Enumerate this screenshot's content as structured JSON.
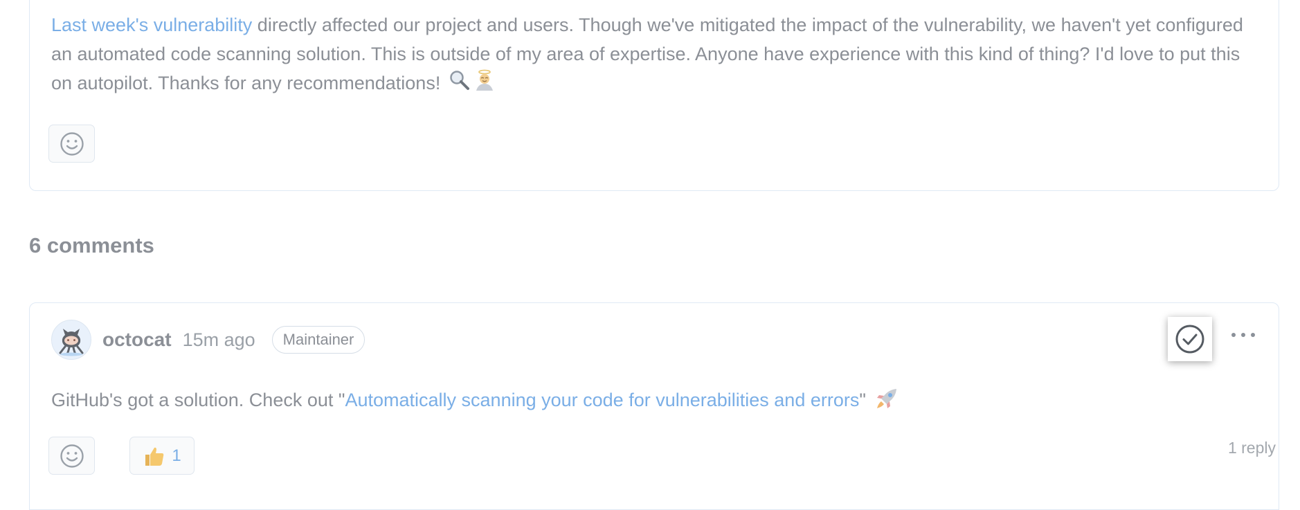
{
  "post": {
    "link_text": "Last week's vulnerability",
    "body_text": " directly affected our project and users. Though we've mitigated the impact of the vulnerability, we haven't yet configured an automated code scanning solution. This is outside of my area of expertise. Anyone have experience with this kind of thing? I'd love to put this on autopilot. Thanks for any recommendations!",
    "emojis": [
      "magnifying-glass-icon",
      "person-with-halo-icon"
    ]
  },
  "comments_section": {
    "heading": "6 comments"
  },
  "comment": {
    "author": "octocat",
    "timestamp": "15m ago",
    "role_badge": "Maintainer",
    "body_prefix": "GitHub's got a solution. Check out \"",
    "link_text": "Automatically scanning your code for vulnerabilities and errors",
    "body_suffix": "\"",
    "emoji": "rocket-icon",
    "thumbs_up_count": "1",
    "reply_count": "1 reply"
  },
  "colors": {
    "link": "#7aaee6",
    "text": "#8b8f96",
    "border": "#dfe9f5"
  }
}
